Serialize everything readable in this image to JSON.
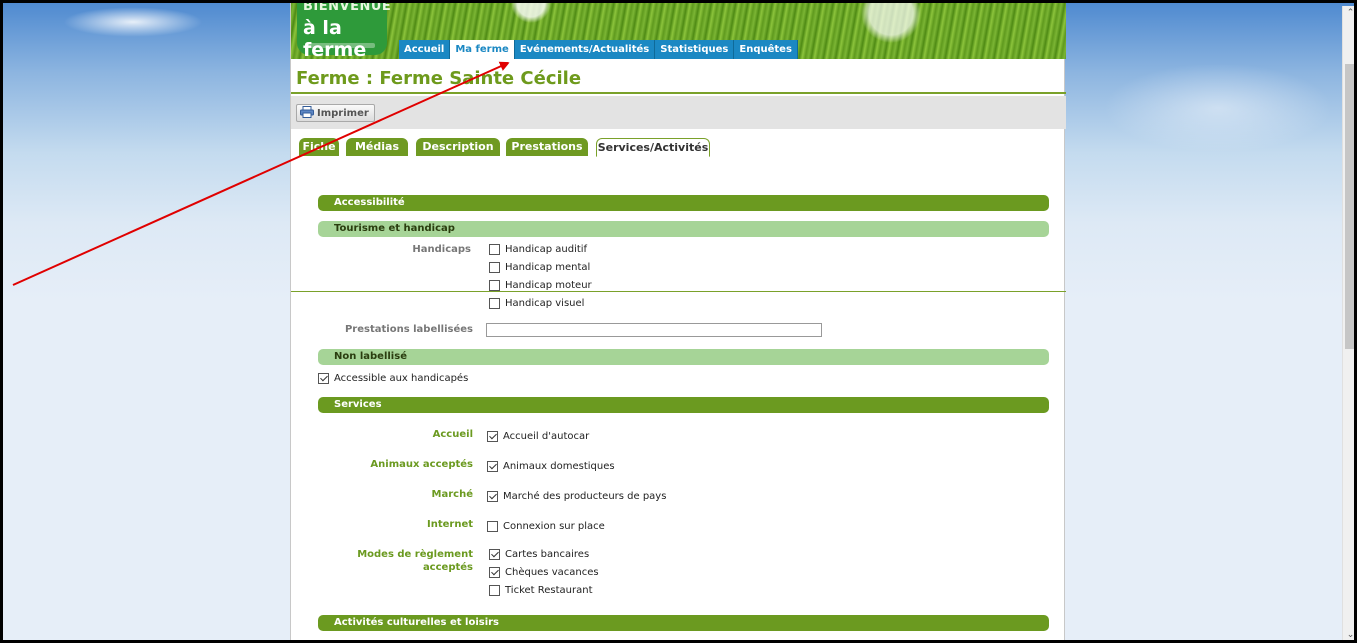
{
  "site": {
    "logo_top": "BIENVENUE",
    "logo_main": "à la ferme"
  },
  "nav": {
    "items": [
      {
        "label": "Accueil",
        "active": false
      },
      {
        "label": "Ma ferme",
        "active": true
      },
      {
        "label": "Evénements/Actualités",
        "active": false
      },
      {
        "label": "Statistiques",
        "active": false
      },
      {
        "label": "Enquêtes",
        "active": false
      }
    ]
  },
  "page": {
    "title": "Ferme : Ferme Sainte Cécile"
  },
  "toolbar": {
    "print_label": "Imprimer"
  },
  "tabs": [
    {
      "label": "Fiche",
      "active": false
    },
    {
      "label": "Médias",
      "active": false
    },
    {
      "label": "Description",
      "active": false
    },
    {
      "label": "Prestations",
      "active": false
    },
    {
      "label": "Services/Activités",
      "active": true
    }
  ],
  "sections": {
    "accessibilite": "Accessibilité",
    "tourisme_handicap": "Tourisme et handicap",
    "non_labellise": "Non labellisé",
    "services": "Services",
    "activites": "Activités culturelles et loisirs"
  },
  "handicaps": {
    "label": "Handicaps",
    "options": [
      {
        "label": "Handicap auditif",
        "checked": false
      },
      {
        "label": "Handicap mental",
        "checked": false
      },
      {
        "label": "Handicap moteur",
        "checked": false
      },
      {
        "label": "Handicap visuel",
        "checked": false
      }
    ]
  },
  "prestations_labellisees": {
    "label": "Prestations labellisées",
    "value": ""
  },
  "non_labellise_option": {
    "label": "Accessible aux handicapés",
    "checked": true
  },
  "services": {
    "accueil": {
      "label": "Accueil",
      "options": [
        {
          "label": "Accueil d'autocar",
          "checked": true
        }
      ]
    },
    "animaux": {
      "label": "Animaux acceptés",
      "options": [
        {
          "label": "Animaux domestiques",
          "checked": true
        }
      ]
    },
    "marche": {
      "label": "Marché",
      "options": [
        {
          "label": "Marché des producteurs de pays",
          "checked": true
        }
      ]
    },
    "internet": {
      "label": "Internet",
      "options": [
        {
          "label": "Connexion sur place",
          "checked": false
        }
      ]
    },
    "reglement": {
      "label_line1": "Modes de règlement",
      "label_line2": "acceptés",
      "options": [
        {
          "label": "Cartes bancaires",
          "checked": true
        },
        {
          "label": "Chèques vacances",
          "checked": true
        },
        {
          "label": "Ticket Restaurant",
          "checked": false
        }
      ]
    }
  },
  "colors": {
    "brand_green": "#6b9a20",
    "light_green": "#a6d497",
    "nav_blue": "#1b88c3",
    "annotation_red": "#e00000"
  },
  "scroll_position": 0.0
}
